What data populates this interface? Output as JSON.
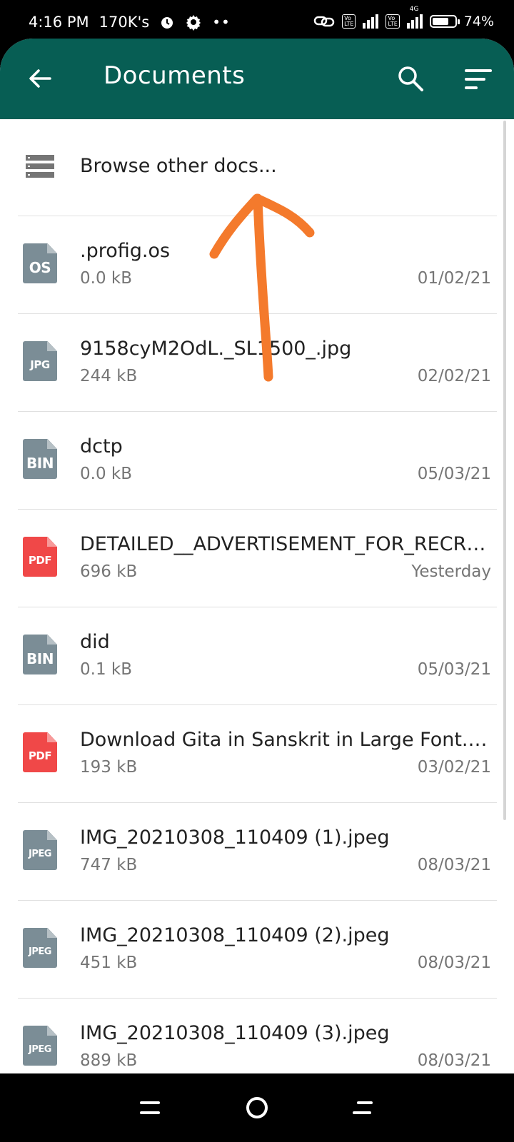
{
  "status_bar": {
    "time": "4:16 PM",
    "carrier": "170K's",
    "network_tag": "4G",
    "battery": "74%",
    "battery_level": 0.74
  },
  "app_bar": {
    "title": "Documents",
    "background": "#075E54",
    "icons": [
      "back-arrow-icon",
      "search-icon",
      "sort-icon"
    ]
  },
  "browse": {
    "label": "Browse other docs..."
  },
  "files": [
    {
      "name": ".profig.os",
      "size": "0.0 kB",
      "date": "01/02/21",
      "type": "OS",
      "color": "#7B8D96"
    },
    {
      "name": "9158cyM2OdL._SL1500_.jpg",
      "size": "244 kB",
      "date": "02/02/21",
      "type": "JPG",
      "color": "#7B8D96"
    },
    {
      "name": "dctp",
      "size": "0.0 kB",
      "date": "05/03/21",
      "type": "BIN",
      "color": "#7B8D96"
    },
    {
      "name": "DETAILED__ADVERTISEMENT_FOR_RECRUITMENT.pdf",
      "size": "696 kB",
      "date": "Yesterday",
      "type": "PDF",
      "color": "#F04848"
    },
    {
      "name": "did",
      "size": "0.1 kB",
      "date": "05/03/21",
      "type": "BIN",
      "color": "#7B8D96"
    },
    {
      "name": "Download Gita in Sanskrit in Large Font.pdf",
      "size": "193 kB",
      "date": "03/02/21",
      "type": "PDF",
      "color": "#F04848"
    },
    {
      "name": "IMG_20210308_110409 (1).jpeg",
      "size": "747 kB",
      "date": "08/03/21",
      "type": "JPEG",
      "color": "#7B8D96"
    },
    {
      "name": "IMG_20210308_110409 (2).jpeg",
      "size": "451 kB",
      "date": "08/03/21",
      "type": "JPEG",
      "color": "#7B8D96"
    },
    {
      "name": "IMG_20210308_110409 (3).jpeg",
      "size": "889 kB",
      "date": "08/03/21",
      "type": "JPEG",
      "color": "#7B8D96"
    }
  ],
  "annotation": {
    "color": "#F47A2C"
  },
  "nav_bar": {
    "icons": [
      "menu-icon",
      "home-circle-icon",
      "back-icon"
    ]
  }
}
